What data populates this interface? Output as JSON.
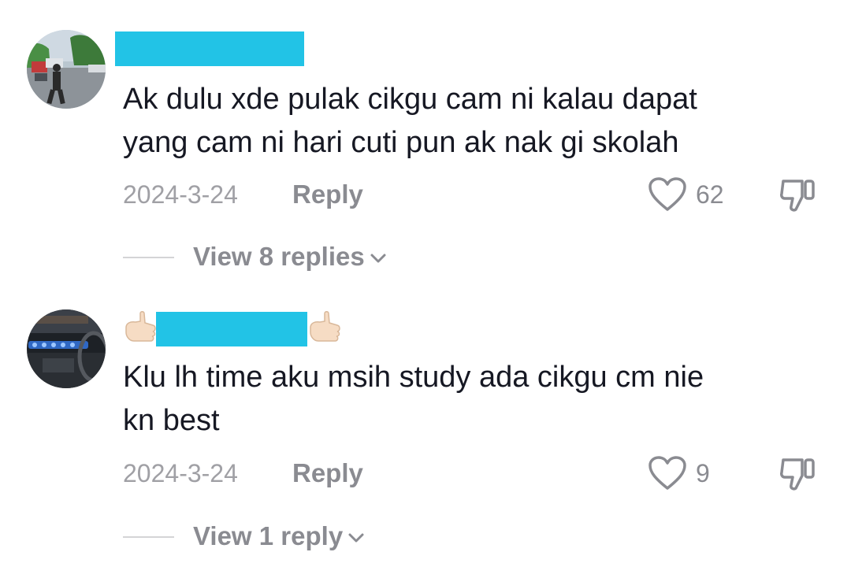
{
  "comments": [
    {
      "text_line1": "Ak dulu xde pulak cikgu cam ni kalau dapat",
      "text_line2": "yang cam ni hari cuti pun ak nak gi skolah",
      "date": "2024-3-24",
      "reply_label": "Reply",
      "likes": "62",
      "view_replies": "View 8 replies"
    },
    {
      "text_line1": "Klu lh time aku msih study ada cikgu cm nie",
      "text_line2": "kn best",
      "date": "2024-3-24",
      "reply_label": "Reply",
      "likes": "9",
      "view_replies": "View 1 reply"
    }
  ],
  "colors": {
    "redaction": "#22c3e6",
    "text": "#161823",
    "muted": "#8a8b91"
  },
  "icons": [
    "heart-icon",
    "dislike-icon",
    "chevron-down-icon",
    "hand-emoji-icon"
  ]
}
